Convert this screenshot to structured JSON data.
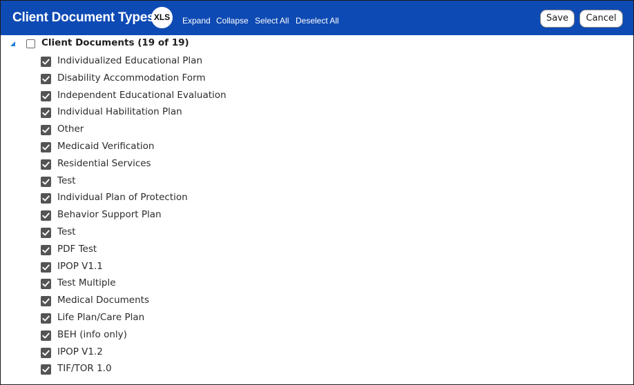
{
  "header": {
    "title": "Client Document Types",
    "xls_label": "XLS",
    "links": {
      "expand": "Expand",
      "collapse": "Collapse",
      "select_all": "Select All",
      "deselect_all": "Deselect All"
    },
    "save_label": "Save",
    "cancel_label": "Cancel"
  },
  "colors": {
    "header_bg": "#0e4ab4",
    "tree_toggle": "#1e7fd8",
    "checkbox_fill": "#545454"
  },
  "icons": {
    "tree_toggle": "triangle-expanded-icon",
    "checked": "checkmark-icon"
  },
  "tree": {
    "parent_label": "Client Documents (19 of 19)",
    "parent_checked": false,
    "items": [
      {
        "label": "Individualized Educational Plan",
        "checked": true
      },
      {
        "label": "Disability Accommodation Form",
        "checked": true
      },
      {
        "label": "Independent Educational Evaluation",
        "checked": true
      },
      {
        "label": "Individual Habilitation Plan",
        "checked": true
      },
      {
        "label": "Other",
        "checked": true
      },
      {
        "label": "Medicaid Verification",
        "checked": true
      },
      {
        "label": "Residential Services",
        "checked": true
      },
      {
        "label": "Test",
        "checked": true
      },
      {
        "label": "Individual Plan of Protection",
        "checked": true
      },
      {
        "label": "Behavior Support Plan",
        "checked": true
      },
      {
        "label": "Test",
        "checked": true
      },
      {
        "label": "PDF Test",
        "checked": true
      },
      {
        "label": "IPOP V1.1",
        "checked": true
      },
      {
        "label": "Test Multiple",
        "checked": true
      },
      {
        "label": "Medical Documents",
        "checked": true
      },
      {
        "label": "Life Plan/Care Plan",
        "checked": true
      },
      {
        "label": "BEH (info only)",
        "checked": true
      },
      {
        "label": "IPOP V1.2",
        "checked": true
      },
      {
        "label": "TIF/TOR 1.0",
        "checked": true
      }
    ]
  }
}
